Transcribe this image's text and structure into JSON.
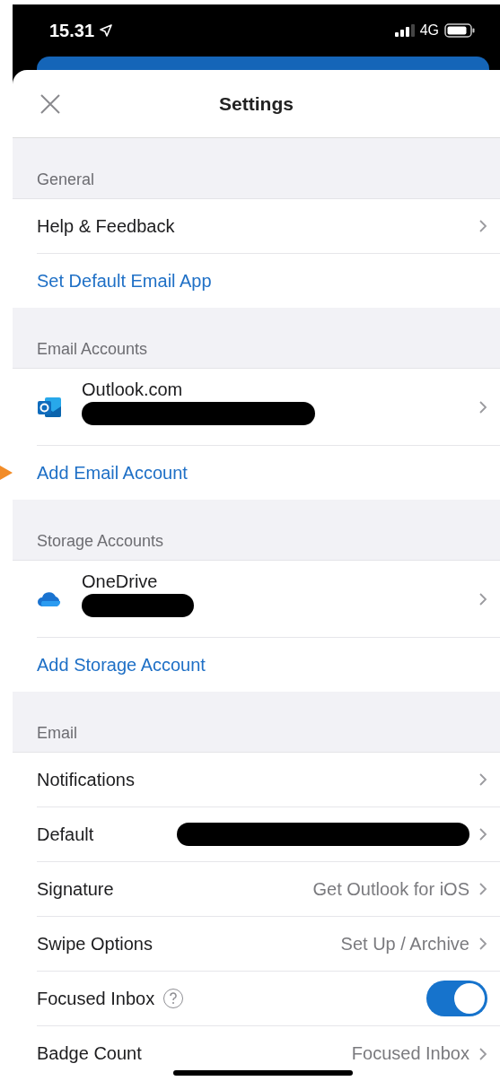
{
  "status_bar": {
    "time": "15.31",
    "network": "4G"
  },
  "header": {
    "title": "Settings"
  },
  "sections": [
    {
      "title": "General",
      "rows": [
        {
          "kind": "nav",
          "label": "Help & Feedback"
        },
        {
          "kind": "link",
          "label": "Set Default Email App"
        }
      ]
    },
    {
      "title": "Email Accounts",
      "rows": [
        {
          "kind": "account",
          "label": "Outlook.com",
          "redacted": true
        },
        {
          "kind": "link",
          "label": "Add Email Account"
        }
      ]
    },
    {
      "title": "Storage Accounts",
      "rows": [
        {
          "kind": "account",
          "label": "OneDrive",
          "redacted": true
        },
        {
          "kind": "link",
          "label": "Add Storage Account"
        }
      ]
    },
    {
      "title": "Email",
      "rows": [
        {
          "kind": "nav",
          "label": "Notifications"
        },
        {
          "kind": "nav",
          "label": "Default",
          "redacted": true
        },
        {
          "kind": "nav",
          "label": "Signature",
          "value": "Get Outlook for iOS"
        },
        {
          "kind": "nav",
          "label": "Swipe Options",
          "value": "Set Up / Archive"
        },
        {
          "kind": "toggle",
          "label": "Focused Inbox",
          "help": true,
          "on": true
        },
        {
          "kind": "nav",
          "label": "Badge Count",
          "value": "Focused Inbox"
        }
      ]
    }
  ]
}
